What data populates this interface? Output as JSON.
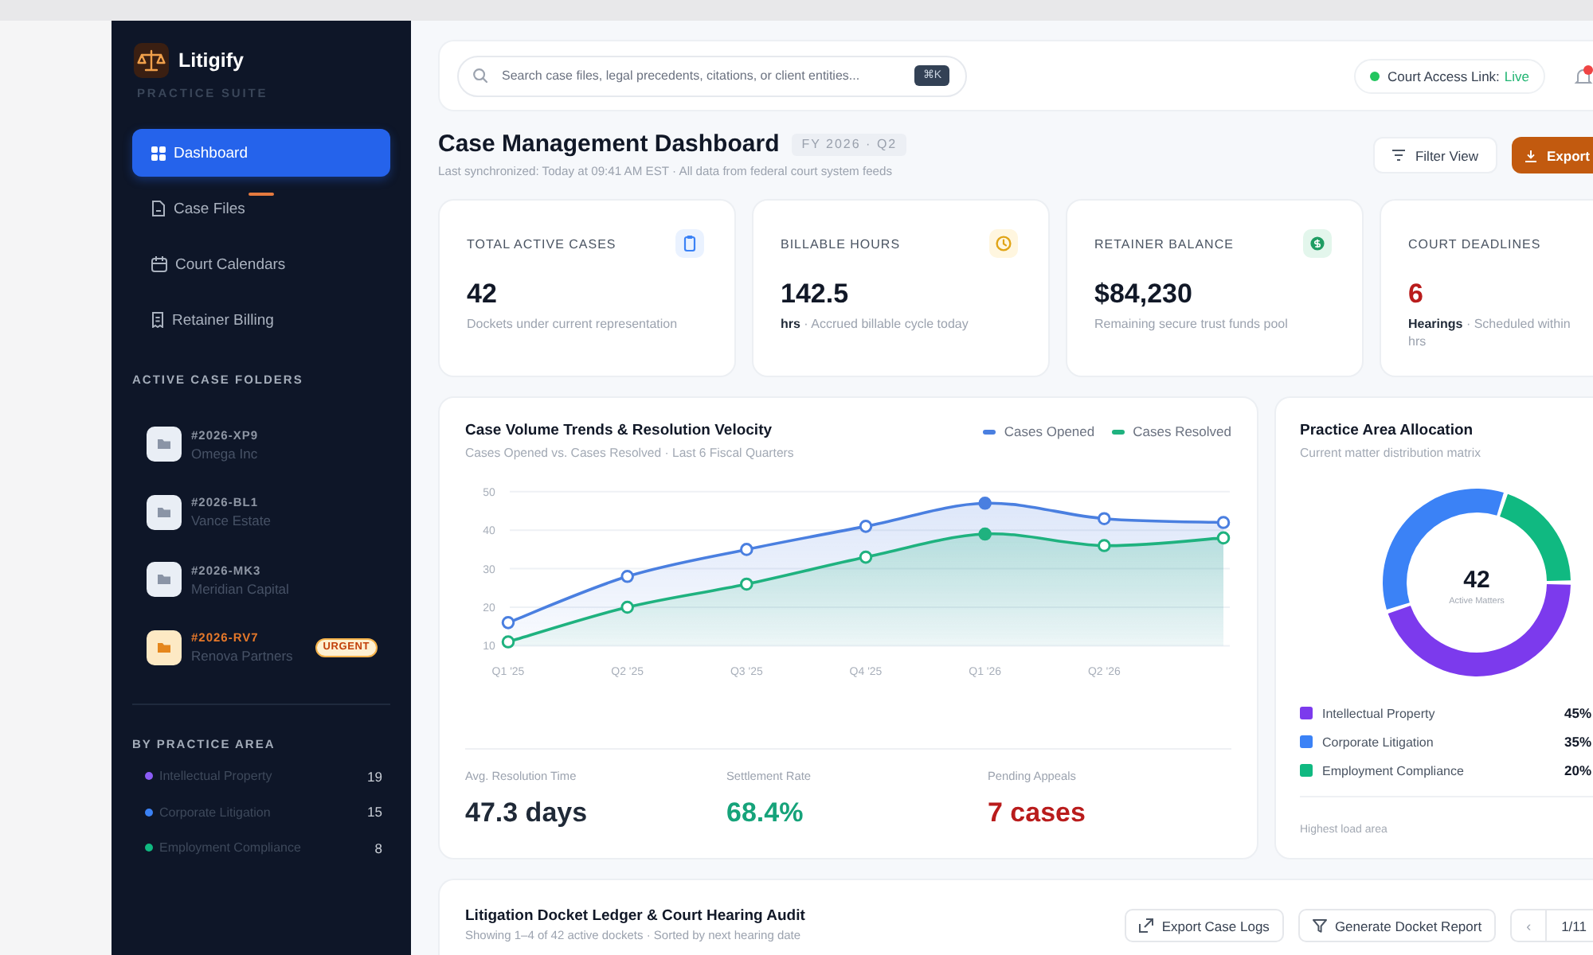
{
  "sidebar": {
    "brand": {
      "name": "Litigify",
      "tagline": "PRACTICE SUITE"
    },
    "nav": [
      {
        "label": "Dashboard",
        "selected": true,
        "flagged": false
      },
      {
        "label": "Case Files",
        "selected": false,
        "flagged": true
      },
      {
        "label": "Court Calendars",
        "selected": false,
        "flagged": false
      },
      {
        "label": "Retainer Billing",
        "selected": false,
        "flagged": false
      }
    ],
    "folders_heading": "ACTIVE CASE FOLDERS",
    "folders": [
      {
        "code": "#2026-XP9",
        "name": "Omega Inc",
        "urgent": false
      },
      {
        "code": "#2026-BL1",
        "name": "Vance Estate",
        "urgent": false
      },
      {
        "code": "#2026-MK3",
        "name": "Meridian Capital",
        "urgent": false
      },
      {
        "code": "#2026-RV7",
        "name": "Renova Partners",
        "urgent": true,
        "badge": "URGENT"
      }
    ],
    "areas_heading": "BY PRACTICE AREA",
    "areas": [
      {
        "label": "Intellectual Property",
        "count": "19",
        "color": "#8b5cf6"
      },
      {
        "label": "Corporate Litigation",
        "count": "15",
        "color": "#3b82f6"
      },
      {
        "label": "Employment Compliance",
        "count": "8",
        "color": "#10b981"
      }
    ]
  },
  "top_bar": {
    "search": {
      "placeholder": "Search case files, legal precedents, citations, or client entities...",
      "shortcut": "⌘K"
    },
    "link_status": {
      "label": "Court Access Link:",
      "value": "Live"
    },
    "notifications": {
      "unread": true
    }
  },
  "header": {
    "title": "Case Management Dashboard",
    "period": "FY 2026 · Q2",
    "subtitle": "Last synchronized: Today at 09:41 AM EST · All data from federal court system feeds",
    "actions": [
      {
        "label": "Filter View",
        "kind": "secondary"
      },
      {
        "label": "Export",
        "kind": "primary"
      }
    ]
  },
  "stats": [
    {
      "label": "TOTAL ACTIVE CASES",
      "value": "42",
      "note": "Dockets under current representation",
      "color": "#111827"
    },
    {
      "label": "BILLABLE HOURS",
      "value": "142.5",
      "note": "**hrs** · Accrued billable cycle today",
      "color": "#111827"
    },
    {
      "label": "RETAINER BALANCE",
      "value": "$84,230",
      "note": "Remaining secure trust funds pool",
      "color": "#111827"
    },
    {
      "label": "COURT DEADLINES",
      "value": "6",
      "note": "**Hearings** · Scheduled within hrs",
      "color": "#b91c1c"
    }
  ],
  "trend_card": {
    "subtitle": "Cases Opened vs. Cases Resolved · Last 6 Fiscal Quarters",
    "chart_data": {
      "type": "area",
      "title": "Case Volume Trends & Resolution Velocity",
      "categories": [
        "Q1 '25",
        "Q2 '25",
        "Q3 '25",
        "Q4 '25",
        "Q1 '26",
        "Q2 '26",
        null
      ],
      "yticks": [
        10,
        20,
        30,
        40,
        50
      ],
      "ylim": [
        10,
        50
      ],
      "grid": true,
      "series": [
        {
          "name": "Cases Opened",
          "color": "#4a7fe0",
          "values": [
            16,
            28,
            35,
            41,
            47,
            43,
            42
          ]
        },
        {
          "name": "Cases Resolved",
          "color": "#1fb27f",
          "values": [
            11,
            20,
            26,
            33,
            39,
            36,
            38
          ]
        }
      ],
      "annotations": [
        {
          "x": "Q1 '26"
        }
      ]
    },
    "metrics": [
      {
        "label": "Avg. Resolution Time",
        "value": "47.3 days",
        "color": "#1f2937"
      },
      {
        "label": "Settlement Rate",
        "value": "68.4%",
        "color": "#16a37a"
      },
      {
        "label": "Pending Appeals",
        "value": "7 cases",
        "color": "#b91c1c"
      }
    ]
  },
  "allocation_card": {
    "title": "Practice Area Allocation",
    "subtitle": "Current matter distribution matrix",
    "chart_data": {
      "type": "donut",
      "categories": [
        "Intellectual Property",
        "Corporate Litigation",
        "Employment Compliance"
      ],
      "values": [
        45,
        35,
        20
      ],
      "colors": [
        "#7c3aed",
        "#3b82f6",
        "#10b981"
      ],
      "value_labels": [
        "45%",
        "35%",
        "20%"
      ]
    },
    "center": {
      "value": "42",
      "label": "Active Matters"
    },
    "footer": "Highest load area"
  },
  "docket_card": {
    "title": "Litigation Docket Ledger & Court Hearing Audit",
    "subtitle": "Showing 1–4 of 42 active dockets · Sorted by next hearing date",
    "actions": [
      {
        "label": "Export Case Logs"
      },
      {
        "label": "Generate Docket Report"
      }
    ],
    "pagination": {
      "previous": "‹",
      "page": "1/11"
    }
  }
}
